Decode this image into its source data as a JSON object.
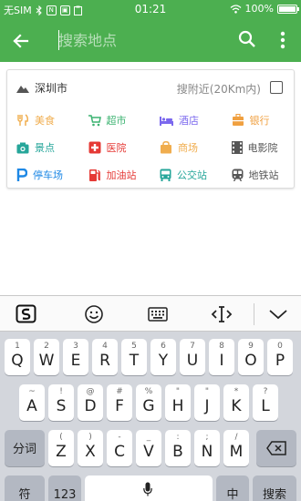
{
  "status_bar": {
    "carrier": "无SIM",
    "time": "01:21",
    "battery": "100%",
    "battery_level": 1.0
  },
  "app_bar": {
    "search_placeholder": "搜索地点",
    "icons": [
      "back-arrow-icon",
      "search-icon",
      "more-vertical-icon"
    ],
    "color": "#4caf50"
  },
  "card": {
    "city": "深圳市",
    "nearby_label": "搜附近(20Km内)",
    "nearby_checked": false,
    "categories": [
      [
        {
          "label": "美食",
          "icon": "fork-knife-icon",
          "color": "#f0ad4e"
        },
        {
          "label": "超市",
          "icon": "shopping-cart-icon",
          "color": "#3cb371"
        },
        {
          "label": "酒店",
          "icon": "bed-icon",
          "color": "#7b68ee"
        },
        {
          "label": "银行",
          "icon": "bank-icon",
          "color": "#f0a040"
        }
      ],
      [
        {
          "label": "景点",
          "icon": "camera-icon",
          "color": "#26a69a"
        },
        {
          "label": "医院",
          "icon": "medical-cross-icon",
          "color": "#e53935"
        },
        {
          "label": "商场",
          "icon": "shopping-bag-icon",
          "color": "#f0ad4e"
        },
        {
          "label": "电影院",
          "icon": "film-icon",
          "color": "#555555"
        }
      ],
      [
        {
          "label": "停车场",
          "icon": "parking-icon",
          "color": "#1e88e5"
        },
        {
          "label": "加油站",
          "icon": "gas-pump-icon",
          "color": "#e53935"
        },
        {
          "label": "公交站",
          "icon": "bus-icon",
          "color": "#26a69a"
        },
        {
          "label": "地铁站",
          "icon": "subway-icon",
          "color": "#555555"
        }
      ]
    ]
  },
  "keyboard": {
    "toolbar_icons": [
      "sogou-logo-icon",
      "emoji-icon",
      "keyboard-icon",
      "cursor-move-icon",
      "collapse-chevron-icon"
    ],
    "row1": [
      {
        "key": "Q",
        "hint": "1"
      },
      {
        "key": "W",
        "hint": "2"
      },
      {
        "key": "E",
        "hint": "3"
      },
      {
        "key": "R",
        "hint": "4"
      },
      {
        "key": "T",
        "hint": "5"
      },
      {
        "key": "Y",
        "hint": "6"
      },
      {
        "key": "U",
        "hint": "7"
      },
      {
        "key": "I",
        "hint": "8"
      },
      {
        "key": "O",
        "hint": "9"
      },
      {
        "key": "P",
        "hint": "0"
      }
    ],
    "row2": [
      {
        "key": "A",
        "hint": "~"
      },
      {
        "key": "S",
        "hint": "!"
      },
      {
        "key": "D",
        "hint": "@"
      },
      {
        "key": "F",
        "hint": "#"
      },
      {
        "key": "G",
        "hint": "%"
      },
      {
        "key": "H",
        "hint": "\""
      },
      {
        "key": "J",
        "hint": "\""
      },
      {
        "key": "K",
        "hint": "*"
      },
      {
        "key": "L",
        "hint": "?"
      }
    ],
    "row3": [
      {
        "key": "Z",
        "hint": "("
      },
      {
        "key": "X",
        "hint": ")"
      },
      {
        "key": "C",
        "hint": "-"
      },
      {
        "key": "V",
        "hint": "_"
      },
      {
        "key": "B",
        "hint": ":"
      },
      {
        "key": "N",
        "hint": ";"
      },
      {
        "key": "M",
        "hint": "/"
      }
    ],
    "fenci": "分词",
    "symbol": "符",
    "num": "123",
    "zhong": "中",
    "search": "搜索"
  }
}
